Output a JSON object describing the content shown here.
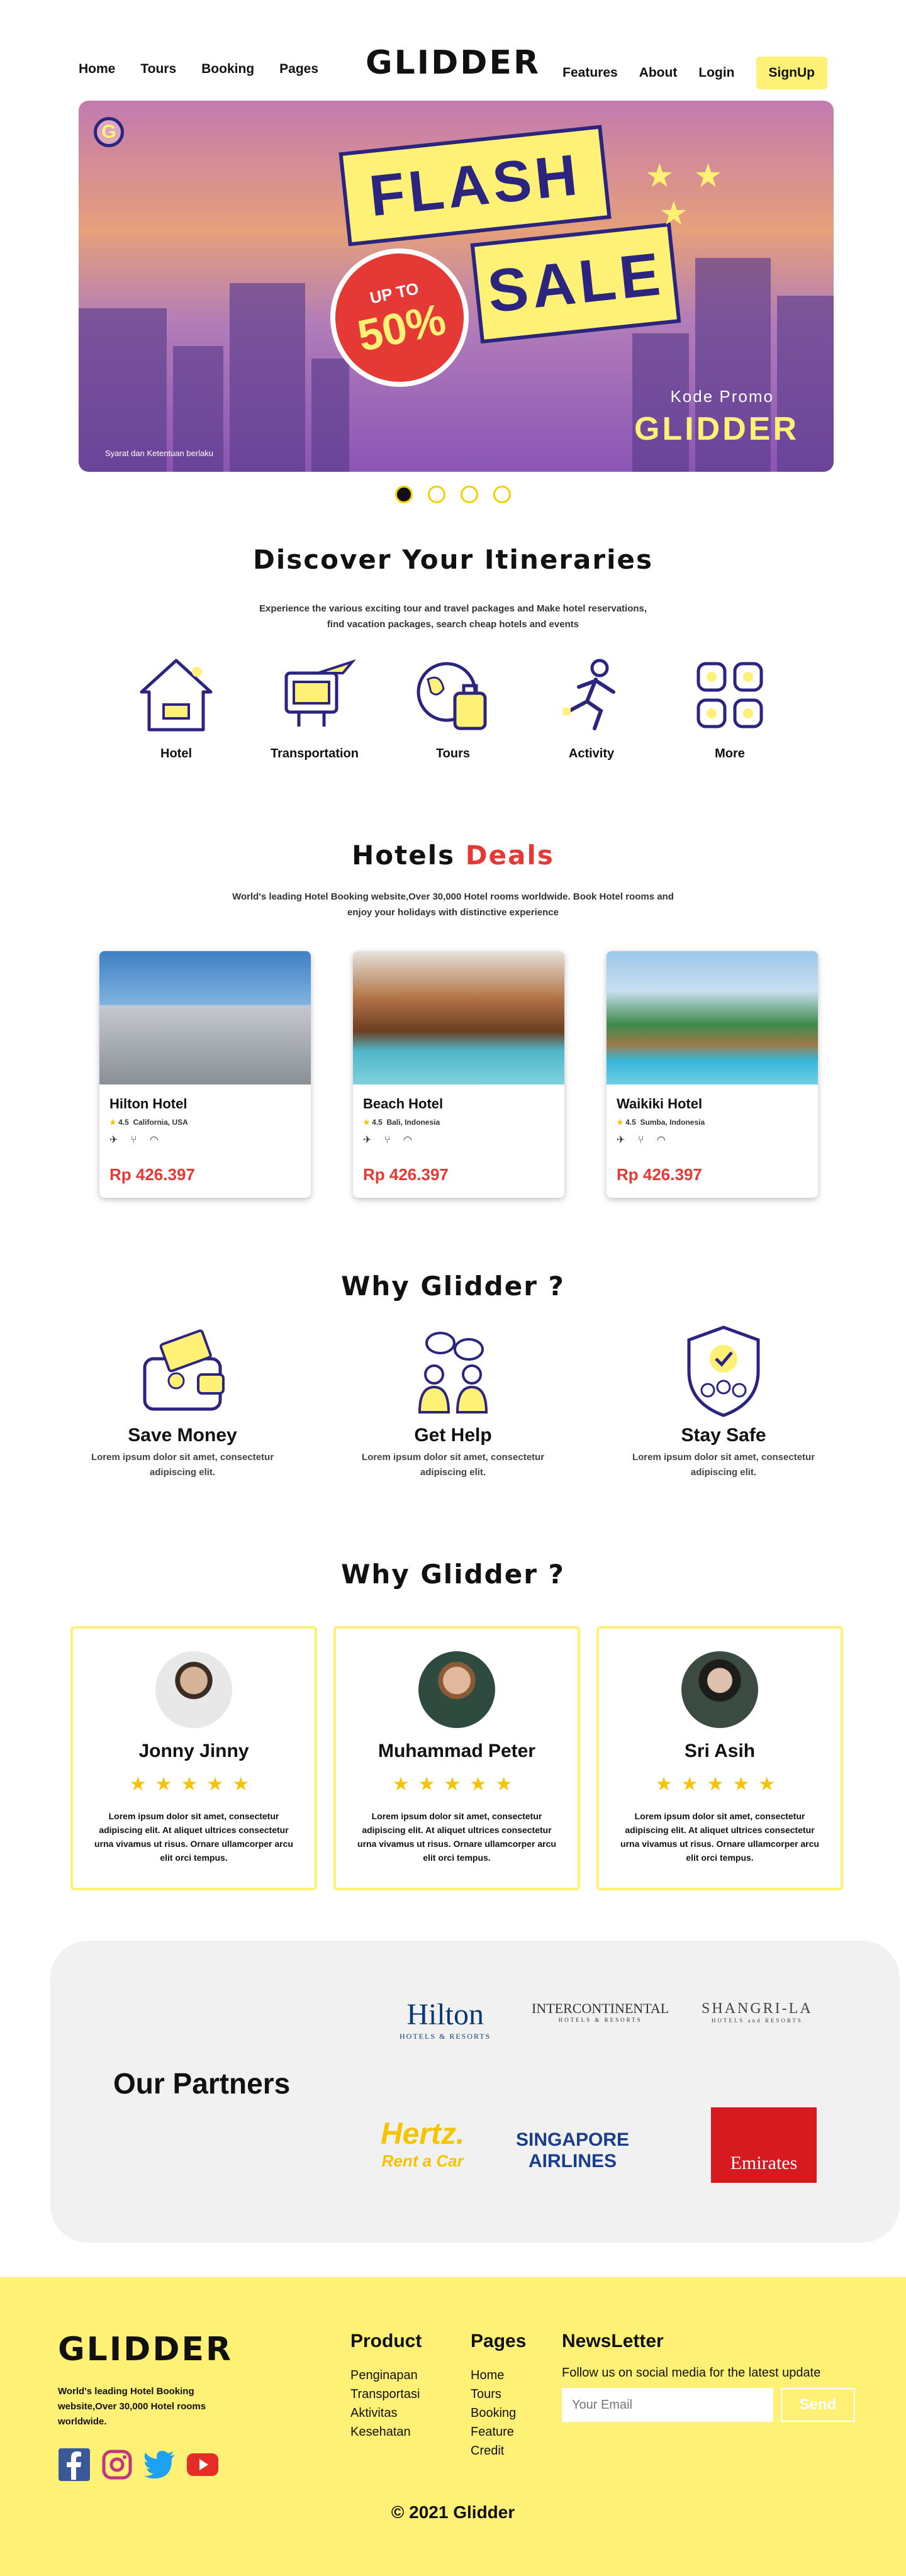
{
  "nav": {
    "left": [
      "Home",
      "Tours",
      "Booking",
      "Pages"
    ],
    "logo": "GLIDDER",
    "right": [
      "Features",
      "About",
      "Login"
    ],
    "signup": "SignUp"
  },
  "hero": {
    "badge": "G",
    "flash": "FLASH",
    "sale": "SALE",
    "upto": "UP TO",
    "percent": "50%",
    "promo_label": "Kode Promo",
    "promo_code": "GLIDDER",
    "terms": "Syarat dan Ketentuan berlaku"
  },
  "carousel": {
    "count": 4,
    "active": 0
  },
  "discover": {
    "title": "Discover Your Itineraries",
    "line1": "Experience the various exciting tour and travel packages and Make hotel reservations,",
    "line2": "find vacation packages, search cheap hotels and events",
    "items": [
      "Hotel",
      "Transportation",
      "Tours",
      "Activity",
      "More"
    ]
  },
  "deals": {
    "title_a": "Hotels",
    "title_b": "Deals",
    "line1": "World's leading Hotel Booking website,Over 30,000 Hotel rooms worldwide. Book Hotel rooms and",
    "line2": "enjoy your holidays with distinctive experience",
    "hotels": [
      {
        "name": "Hilton Hotel",
        "rating": "4.5",
        "location": "California, USA",
        "price": "Rp 426.397"
      },
      {
        "name": "Beach Hotel",
        "rating": "4.5",
        "location": "Bali, Indonesia",
        "price": "Rp 426.397"
      },
      {
        "name": "Waikiki Hotel",
        "rating": "4.5",
        "location": "Sumba, Indonesia",
        "price": "Rp 426.397"
      }
    ]
  },
  "why": {
    "title": "Why Glidder ?",
    "items": [
      {
        "title": "Save Money",
        "l1": "Lorem ipsum dolor sit amet, consectetur",
        "l2": "adipiscing elit."
      },
      {
        "title": "Get Help",
        "l1": "Lorem ipsum dolor sit amet, consectetur",
        "l2": "adipiscing elit."
      },
      {
        "title": "Stay Safe",
        "l1": "Lorem ipsum dolor sit amet, consectetur",
        "l2": "adipiscing elit."
      }
    ]
  },
  "testimonials": {
    "title": "Why Glidder ?",
    "items": [
      {
        "name": "Jonny Jinny",
        "rating": 5,
        "text": "Lorem ipsum dolor sit amet, consectetur adipiscing elit. At aliquet ultrices consectetur urna vivamus ut risus. Ornare ullamcorper arcu elit orci tempus."
      },
      {
        "name": "Muhammad Peter",
        "rating": 5,
        "text": "Lorem ipsum dolor sit amet, consectetur adipiscing elit. At aliquet ultrices consectetur urna vivamus ut risus. Ornare ullamcorper arcu elit orci tempus."
      },
      {
        "name": "Sri Asih",
        "rating": 5,
        "text": "Lorem ipsum dolor sit amet, consectetur adipiscing elit. At aliquet ultrices consectetur urna vivamus ut risus. Ornare ullamcorper arcu elit orci tempus."
      }
    ]
  },
  "partners": {
    "title": "Our Partners",
    "hilton": "Hilton",
    "hilton_sub": "HOTELS & RESORTS",
    "ic": "INTERCONTINENTAL",
    "ic_sub": "HOTELS & RESORTS",
    "sl": "SHANGRI-LA",
    "sl_sub": "HOTELS and RESORTS",
    "hertz": "Hertz.",
    "hertz_sub": "Rent a Car",
    "sia": "SINGAPORE",
    "sia_sub": "AIRLINES",
    "emirates": "Emirates"
  },
  "footer": {
    "logo": "GLIDDER",
    "desc": "World's leading Hotel Booking website,Over 30,000 Hotel rooms worldwide.",
    "product_title": "Product",
    "product": [
      "Penginapan",
      "Transportasi",
      "Aktivitas",
      "Kesehatan"
    ],
    "pages_title": "Pages",
    "pages": [
      "Home",
      "Tours",
      "Booking",
      "Feature",
      "Credit"
    ],
    "news_title": "NewsLetter",
    "news_text": "Follow us on social media for the latest update",
    "email_placeholder": "Your Email",
    "send": "Send",
    "copyright": "© 2021 Glidder"
  },
  "colors": {
    "yellow": "#fff176",
    "red": "#e53935",
    "navy": "#2b2580"
  }
}
